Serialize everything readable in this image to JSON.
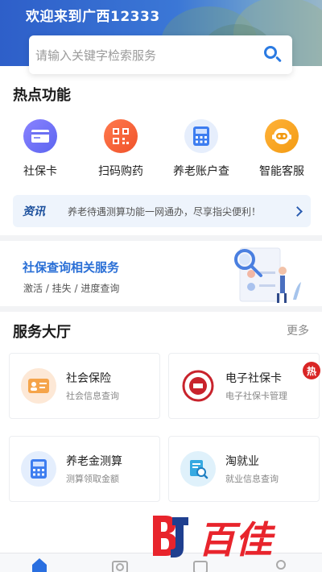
{
  "header": {
    "title": "欢迎来到广西12333"
  },
  "search": {
    "placeholder": "请输入关键字检索服务"
  },
  "hot": {
    "title": "热点功能",
    "items": [
      {
        "label": "社保卡",
        "icon": "card-icon"
      },
      {
        "label": "扫码购药",
        "icon": "qr-code-icon"
      },
      {
        "label": "养老账户查",
        "icon": "calculator-icon"
      },
      {
        "label": "智能客服",
        "icon": "robot-icon"
      }
    ]
  },
  "news": {
    "tag": "资讯",
    "text": "养老待遇测算功能一网通办，尽享指尖便利！"
  },
  "banner": {
    "title": "社保查询相关服务",
    "subtitle": "激活 / 挂失 / 进度查询"
  },
  "hall": {
    "title": "服务大厅",
    "more": "更多",
    "cards": [
      {
        "title": "社会保险",
        "subtitle": "社会信息查询",
        "icon": "id-card-icon"
      },
      {
        "title": "电子社保卡",
        "subtitle": "电子社保卡管理",
        "icon": "social-security-seal-icon",
        "badge": "热"
      },
      {
        "title": "养老金测算",
        "subtitle": "测算领取金额",
        "icon": "calculator-icon"
      },
      {
        "title": "淘就业",
        "subtitle": "就业信息查询",
        "icon": "document-search-icon"
      }
    ]
  },
  "watermark": {
    "text": "百佳"
  },
  "colors": {
    "primary": "#2a7ae2",
    "hot_badge": "#d92525",
    "watermark": "#e8242c"
  }
}
